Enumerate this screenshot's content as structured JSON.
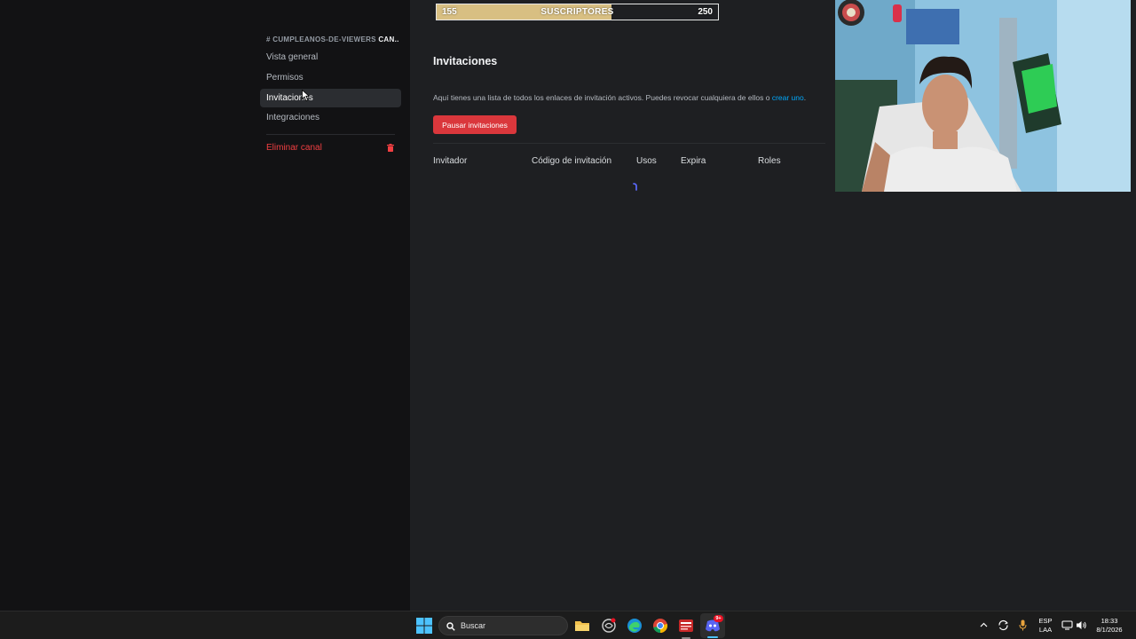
{
  "sidebar": {
    "channel_hash": "#",
    "channel_name_dim": "CUMPLEANOS-DE-VIEWERS",
    "channel_name_bright": "CAN...",
    "items": [
      {
        "label": "Vista general"
      },
      {
        "label": "Permisos"
      },
      {
        "label": "Invitaciones"
      },
      {
        "label": "Integraciones"
      }
    ],
    "delete_label": "Eliminar canal"
  },
  "subscriber_goal": {
    "current": "155",
    "label": "SUSCRIPTORES",
    "goal": "250",
    "progress_fraction": 0.62,
    "fill_color": "#d8bf82"
  },
  "main": {
    "title": "Invitaciones",
    "description": "Aquí tienes una lista de todos los enlaces de invitación activos. Puedes revocar cualquiera de ellos o",
    "description_link": "crear uno",
    "description_end": ".",
    "pause_button": "Pausar invitaciones",
    "columns": [
      "Invitador",
      "Código de invitación",
      "Usos",
      "Expira",
      "Roles"
    ]
  },
  "taskbar": {
    "search_placeholder": "Buscar",
    "lang_top": "ESP",
    "lang_bottom": "LAA",
    "time": "18:33",
    "date": "8/1/2026",
    "discord_badge": "9+"
  },
  "colors": {
    "accent_red": "#da373c",
    "danger_text": "#f23f42",
    "link": "#00a8fc"
  }
}
